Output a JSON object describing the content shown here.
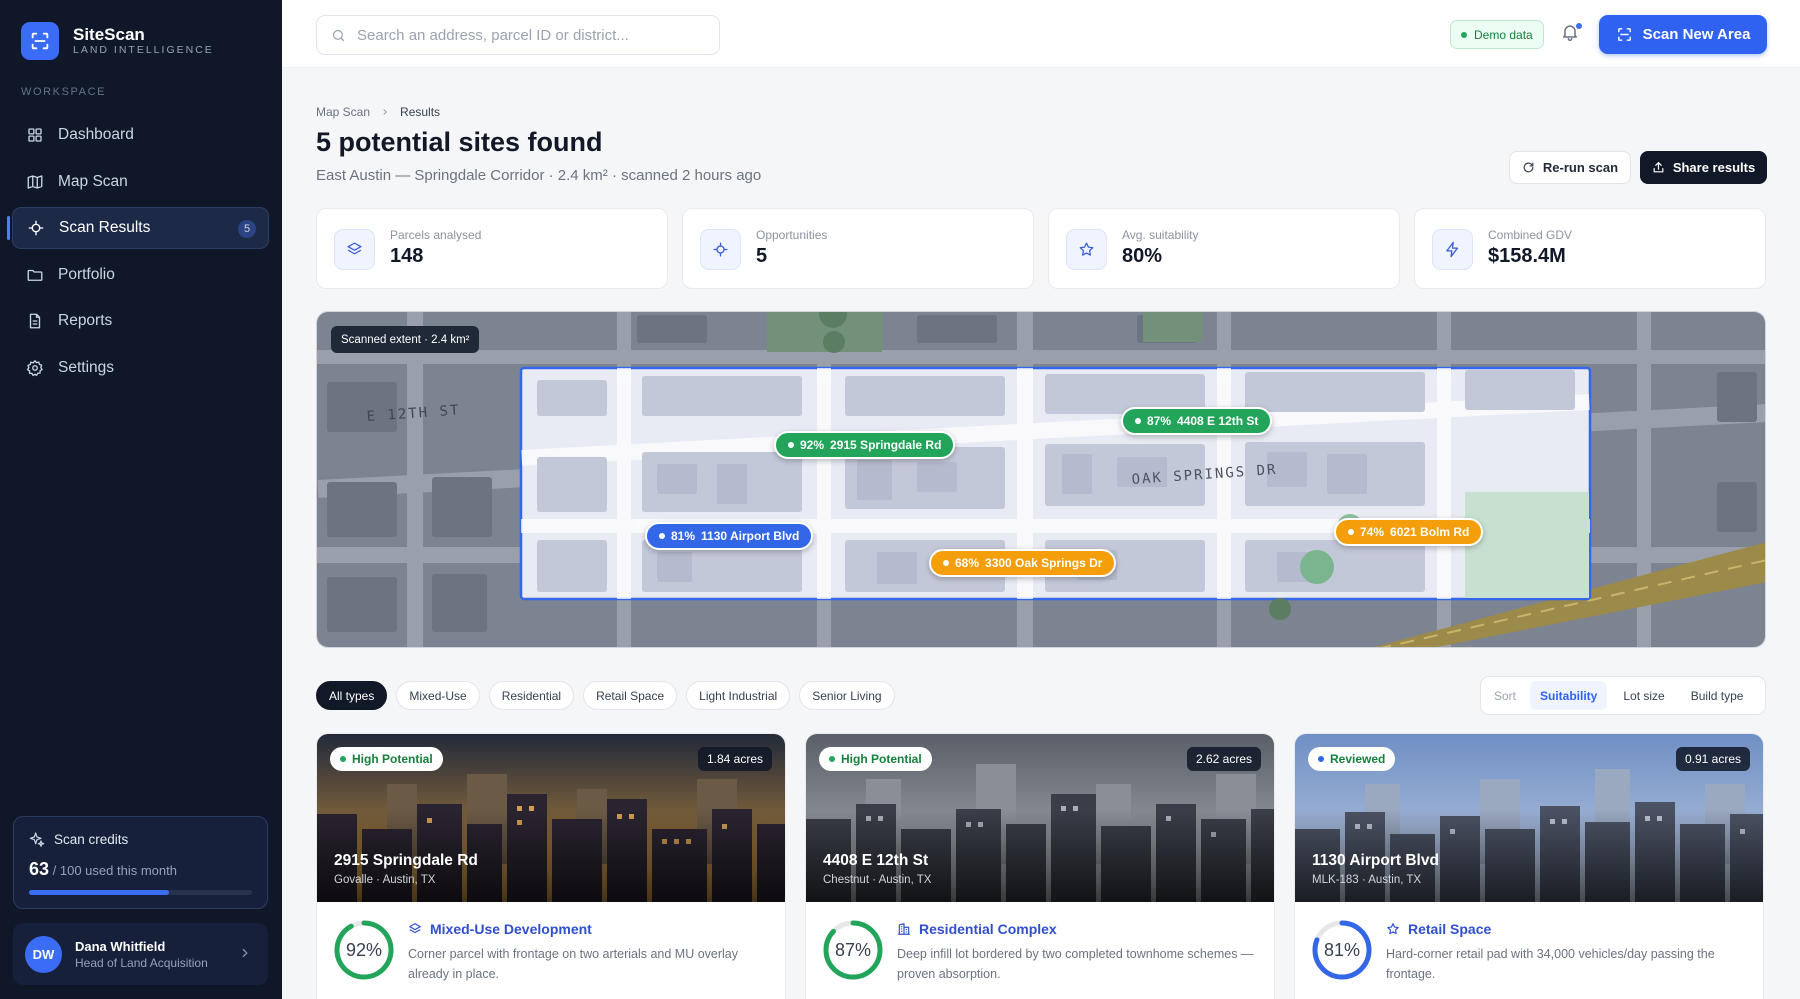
{
  "brand": {
    "name": "SiteScan",
    "tagline": "LAND INTELLIGENCE"
  },
  "sidebar": {
    "section_label": "WORKSPACE",
    "items": [
      {
        "label": "Dashboard",
        "icon": "grid-icon"
      },
      {
        "label": "Map Scan",
        "icon": "map-icon"
      },
      {
        "label": "Scan Results",
        "icon": "crosshair-icon",
        "badge": "5",
        "active": true
      },
      {
        "label": "Portfolio",
        "icon": "folder-icon"
      },
      {
        "label": "Reports",
        "icon": "document-icon"
      },
      {
        "label": "Settings",
        "icon": "gear-icon"
      }
    ],
    "credits": {
      "title": "Scan credits",
      "used": "63",
      "suffix": "/ 100 used this month",
      "fraction": 0.63
    },
    "user": {
      "initials": "DW",
      "name": "Dana Whitfield",
      "role": "Head of Land Acquisition"
    }
  },
  "topbar": {
    "search_placeholder": "Search an address, parcel ID or district...",
    "demo_label": "Demo data",
    "scan_button": "Scan New Area"
  },
  "page": {
    "breadcrumb": [
      "Map Scan",
      "Results"
    ],
    "title": "5 potential sites found",
    "subtitle": "East Austin — Springdale Corridor · 2.4 km² · scanned 2 hours ago",
    "rerun_label": "Re-run scan",
    "share_label": "Share results"
  },
  "stats": [
    {
      "label": "Parcels analysed",
      "value": "148",
      "icon": "layers-icon"
    },
    {
      "label": "Opportunities",
      "value": "5",
      "icon": "crosshair-icon"
    },
    {
      "label": "Avg. suitability",
      "value": "80%",
      "icon": "star-icon"
    },
    {
      "label": "Combined GDV",
      "value": "$158.4M",
      "icon": "lightning-icon"
    }
  ],
  "map": {
    "extent_label": "Scanned extent · 2.4 km²",
    "street_labels": [
      "E 12TH ST",
      "OAK SPRINGS DR"
    ],
    "pins": [
      {
        "score": "92%",
        "name": "2915 Springdale Rd",
        "color": "green"
      },
      {
        "score": "87%",
        "name": "4408 E 12th St",
        "color": "green"
      },
      {
        "score": "81%",
        "name": "1130 Airport Blvd",
        "color": "blue"
      },
      {
        "score": "68%",
        "name": "3300 Oak Springs Dr",
        "color": "amber"
      },
      {
        "score": "74%",
        "name": "6021 Bolm Rd",
        "color": "amber"
      }
    ]
  },
  "filters": {
    "chips": [
      "All types",
      "Mixed-Use",
      "Residential",
      "Retail Space",
      "Light Industrial",
      "Senior Living"
    ],
    "active": 0
  },
  "sort": {
    "label": "Sort",
    "options": [
      "Suitability",
      "Lot size",
      "Build type"
    ],
    "active": 0
  },
  "colors": {
    "accent": "#2f62f0",
    "sidebar": "#0f1729",
    "success": "#22a55b",
    "warning": "#f59e0b"
  },
  "cards": [
    {
      "status": "High Potential",
      "acres": "1.84 acres",
      "address": "2915 Springdale Rd",
      "area": "Govalle · Austin, TX",
      "score": "92%",
      "score_value": 0.92,
      "type": "Mixed-Use Development",
      "type_icon": "layers-icon",
      "description": "Corner parcel with frontage on two arterials and MU overlay already in place.",
      "ring_color": "#22a55b",
      "sky": "sunset"
    },
    {
      "status": "High Potential",
      "acres": "2.62 acres",
      "address": "4408 E 12th St",
      "area": "Chestnut · Austin, TX",
      "score": "87%",
      "score_value": 0.87,
      "type": "Residential Complex",
      "type_icon": "building-icon",
      "description": "Deep infill lot bordered by two completed townhome schemes — proven absorption.",
      "ring_color": "#22a55b",
      "sky": "grey"
    },
    {
      "status": "Reviewed",
      "acres": "0.91 acres",
      "address": "1130 Airport Blvd",
      "area": "MLK-183 · Austin, TX",
      "score": "81%",
      "score_value": 0.81,
      "type": "Retail Space",
      "type_icon": "star-icon",
      "description": "Hard-corner retail pad with 34,000 vehicles/day passing the frontage.",
      "ring_color": "#3467e8",
      "sky": "blue"
    }
  ]
}
